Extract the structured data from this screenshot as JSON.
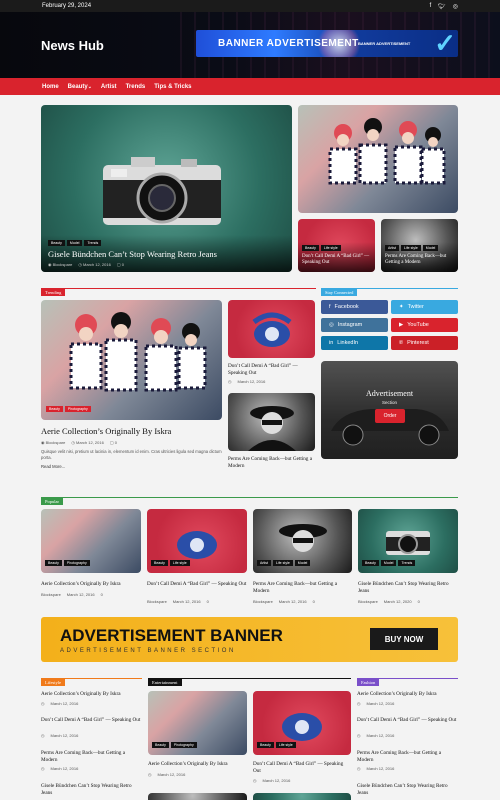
{
  "topbar": {
    "date": "February 29, 2024",
    "social_icons": [
      "facebook-icon",
      "twitter-icon",
      "instagram-icon"
    ]
  },
  "header": {
    "logo": "News Hub",
    "banner_title": "BANNER ADVERTISEMENT",
    "banner_sub": "BANNER ADVERTISEMENT"
  },
  "nav": {
    "items": [
      "Home",
      "Beauty",
      "Artist",
      "Trends",
      "Tips & Tricks"
    ],
    "dropdown_mark": "⌄"
  },
  "colors": {
    "accent": "#d9232d",
    "facebook": "#3b5998",
    "twitter": "#39a9e0",
    "instagram": "#3f729b",
    "youtube": "#d9232d",
    "linkedin": "#0e76a8",
    "pinterest": "#cb2027",
    "popular": "#3a9a4a",
    "lifestyle": "#f07a1a",
    "fashion": "#7a4fc9",
    "ad_yellow": "#f3b01a"
  },
  "hero": {
    "main": {
      "tags": [
        "Beauty",
        "Model",
        "Trends"
      ],
      "title": "Gisele Bündchen Can’t Stop Wearing Retro Jeans",
      "author": "Blockspare",
      "date": "March 12, 2016",
      "comments": "0"
    },
    "side1": {
      "tags": [
        "Beauty",
        "Life style"
      ],
      "title": "Don’t Call Demi A “Bad Girl” — Speaking Out"
    },
    "side2": {
      "tags": [
        "Artist",
        "Life style",
        "Model"
      ],
      "title": "Perms Are Coming Back—but Getting a Modern"
    }
  },
  "trending": {
    "label": "Trending",
    "feature": {
      "tags": [
        "Beauty",
        "Photography"
      ],
      "title": "Aerie Collection’s Originally By Iskra",
      "author": "Blockspare",
      "date": "March 12, 2016",
      "comments": "0",
      "excerpt": "Quisque velit nisi, pretium ut lacinia in, elementum id enim. Cras ultricies ligula sed magna dictum porta.",
      "more": "Read More..."
    },
    "side": [
      {
        "title": "Don’t Call Demi A “Bad Girl” — Speaking Out",
        "date": "March 12, 2016"
      },
      {
        "title": "Perms Are Coming Back—but Getting a Modern",
        "date": "March 12, 2016"
      }
    ]
  },
  "connected": {
    "label": "Stay Connected",
    "buttons": [
      {
        "label": "Facebook",
        "icon": "facebook-icon"
      },
      {
        "label": "Twitter",
        "icon": "twitter-icon"
      },
      {
        "label": "Instagram",
        "icon": "instagram-icon"
      },
      {
        "label": "YouTube",
        "icon": "youtube-icon"
      },
      {
        "label": "LinkedIn",
        "icon": "linkedin-icon"
      },
      {
        "label": "Pinterest",
        "icon": "pinterest-icon"
      }
    ],
    "ad": {
      "title": "Advertisement",
      "sub": "Section",
      "button": "Order"
    }
  },
  "popular": {
    "label": "Popular",
    "items": [
      {
        "tags": [
          "Beauty",
          "Photography"
        ],
        "title": "Aerie Collection’s Originally By Iskra",
        "author": "Blockspare",
        "date": "March 12, 2016",
        "comments": "0"
      },
      {
        "tags": [
          "Beauty",
          "Life style"
        ],
        "title": "Don’t Call Demi A “Bad Girl” — Speaking Out",
        "author": "Blockspare",
        "date": "March 12, 2016",
        "comments": "0"
      },
      {
        "tags": [
          "Artist",
          "Life style",
          "Model"
        ],
        "title": "Perms Are Coming Back—but Getting a Modern",
        "author": "Blockspare",
        "date": "March 12, 2016",
        "comments": "0"
      },
      {
        "tags": [
          "Beauty",
          "Model",
          "Trends"
        ],
        "title": "Gisele Bündchen Can’t Stop Wearing Retro Jeans",
        "author": "Blockspare",
        "date": "March 12, 2020",
        "comments": "0"
      }
    ]
  },
  "ad_banner": {
    "title": "ADVERTISEMENT BANNER",
    "sub": "ADVERTISEMENT BANNER SECTION",
    "button": "BUY NOW"
  },
  "lifestyle": {
    "label": "Lifestyle",
    "items": [
      {
        "title": "Aerie Collection’s Originally By Iskra",
        "date": "March 12, 2016"
      },
      {
        "title": "Don’t Call Demi A “Bad Girl” — Speaking Out",
        "date": "March 12, 2016"
      },
      {
        "title": "Perms Are Coming Back—but Getting a Modern",
        "date": "March 12, 2016"
      },
      {
        "title": "Gisele Bündchen Can’t Stop Wearing Retro Jeans",
        "date": ""
      }
    ]
  },
  "entertainment": {
    "label": "Entertainment",
    "items": [
      {
        "tags": [
          "Beauty",
          "Photography"
        ],
        "title": "Aerie Collection’s Originally By Iskra",
        "date": "March 12, 2016"
      },
      {
        "tags": [
          "Beauty",
          "Life style"
        ],
        "title": "Don’t Call Demi A “Bad Girl” — Speaking Out",
        "date": "March 12, 2016"
      }
    ]
  },
  "fashion": {
    "label": "Fashion",
    "items": [
      {
        "title": "Aerie Collection’s Originally By Iskra",
        "date": "March 12, 2016"
      },
      {
        "title": "Don’t Call Demi A “Bad Girl” — Speaking Out",
        "date": "March 12, 2016"
      },
      {
        "title": "Perms Are Coming Back—but Getting a Modern",
        "date": "March 12, 2016"
      },
      {
        "title": "Gisele Bündchen Can’t Stop Wearing Retro Jeans",
        "date": ""
      }
    ]
  }
}
